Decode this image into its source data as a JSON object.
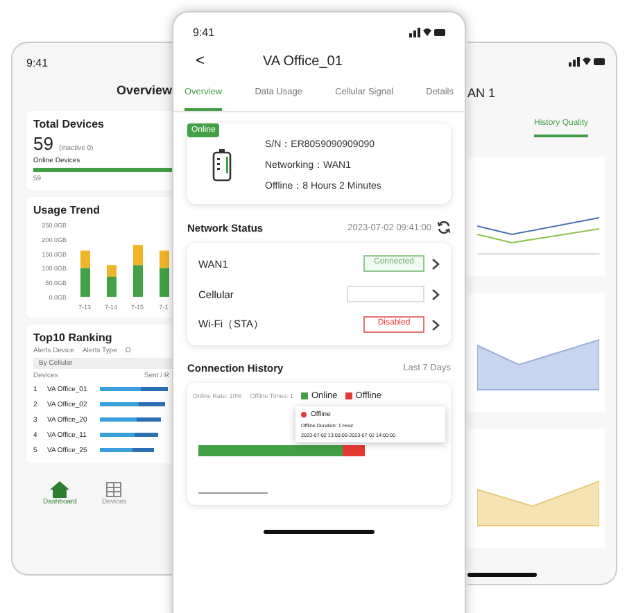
{
  "left_phone": {
    "time": "9:41",
    "title": "Overview",
    "total_devices": {
      "title": "Total Devices",
      "count": "59",
      "inactive": "(Inactive 0)",
      "label": "Online Devices",
      "level": 1,
      "online": "59"
    },
    "usage_trend": {
      "title": "Usage Trend",
      "chart_data": {
        "type": "bar",
        "stacked": true,
        "categories": [
          "7-13",
          "7-14",
          "7-15",
          "7-1"
        ],
        "ylim": [
          0,
          250
        ],
        "yticks": [
          {
            "value": 0,
            "label": "0.0GB"
          },
          {
            "value": 50,
            "label": "50.0GB"
          },
          {
            "value": 100,
            "label": "100.0GB"
          },
          {
            "value": 150,
            "label": "150.0GB"
          },
          {
            "value": 200,
            "label": "200.0GB"
          },
          {
            "value": 250,
            "label": "250.0GB"
          }
        ],
        "series": [
          {
            "color": "#43a047",
            "values": [
              100,
              70,
              110,
              100
            ]
          },
          {
            "color": "#f0b429",
            "values": [
              60,
              40,
              70,
              60
            ]
          }
        ]
      }
    },
    "ranking": {
      "title": "Top10 Ranking",
      "tabs": [
        "Alerts Device",
        "Alerts Type",
        "O"
      ],
      "filter": "By Cellular",
      "columns": [
        "Devices",
        "Sent / R"
      ],
      "rows": [
        {
          "rank": "1",
          "name": "VA Office_01",
          "level": 0.95
        },
        {
          "rank": "2",
          "name": "VA Office_02",
          "level": 0.9
        },
        {
          "rank": "3",
          "name": "VA Office_20",
          "level": 0.85
        },
        {
          "rank": "4",
          "name": "VA Office_11",
          "level": 0.8
        },
        {
          "rank": "5",
          "name": "VA Office_25",
          "level": 0.75
        }
      ]
    },
    "nav": [
      {
        "label": "Dashboard",
        "selected": true,
        "kind": "home"
      },
      {
        "label": "Devices",
        "selected": false,
        "kind": "devices"
      }
    ]
  },
  "center_phone": {
    "time": "9:41",
    "back": "<",
    "title": "VA Office_01",
    "tabs": [
      {
        "label": "Overview",
        "selected": true
      },
      {
        "label": "Data Usage",
        "selected": false
      },
      {
        "label": "Cellular Signal",
        "selected": false
      },
      {
        "label": "Details",
        "selected": false
      }
    ],
    "device": {
      "status": "Online",
      "online": true,
      "sn": "S/N：ER8059090909090",
      "networking": "Networking：WAN1",
      "offline": "Offline：8 Hours 2 Minutes"
    },
    "network_status": {
      "title": "Network Status",
      "time": "2023-07-02 09:41:00",
      "rows": [
        {
          "name": "WAN1",
          "status": "Connected",
          "kind": "connected"
        },
        {
          "name": "Cellular",
          "kind": "unknown"
        },
        {
          "name": "Wi-Fi（STA）",
          "status": "Disabled",
          "kind": "disabled"
        }
      ]
    },
    "connection_history": {
      "title": "Connection History",
      "range": "Last 7 Days",
      "online_rate": "Online Rate: 10%",
      "offline_times": "Offline Times: 1",
      "legend": [
        {
          "label": "Online",
          "color": "#43a047"
        },
        {
          "label": "Offline",
          "color": "#e53935"
        }
      ],
      "tooltip": {
        "title": "Offline",
        "duration": "Offline Duration: 1 Hour",
        "range": "2023-07-02 13:00:00-2023-07-02 14:00:00"
      }
    }
  },
  "right_phone": {
    "title": "AN 1",
    "tabs": [
      {
        "label": "History Quality",
        "selected": true
      }
    ]
  }
}
